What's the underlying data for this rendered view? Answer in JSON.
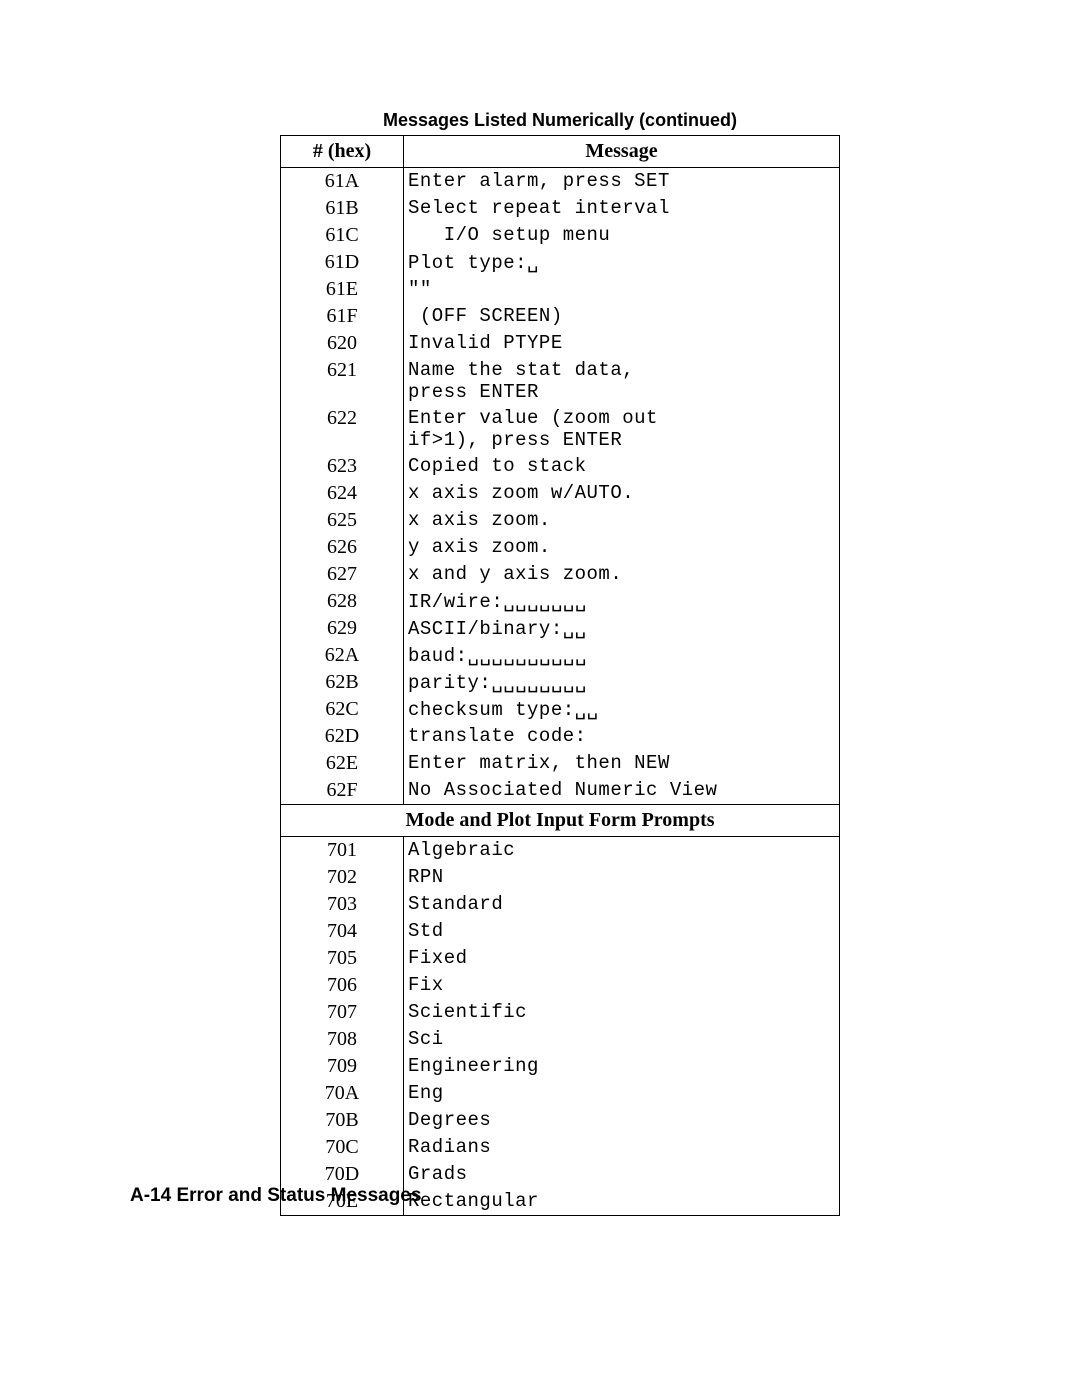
{
  "caption": "Messages Listed Numerically (continued)",
  "headers": {
    "hex": "# (hex)",
    "msg": "Message"
  },
  "section_title": "Mode and Plot Input Form Prompts",
  "footer": "A-14   Error and Status Messages",
  "rows1": [
    {
      "hex": "61A",
      "msg": "Enter alarm, press SET"
    },
    {
      "hex": "61B",
      "msg": "Select repeat interval"
    },
    {
      "hex": "61C",
      "msg": "   I/O setup menu"
    },
    {
      "hex": "61D",
      "msg": "Plot type:␣"
    },
    {
      "hex": "61E",
      "msg": "\"\""
    },
    {
      "hex": "61F",
      "msg": " (OFF SCREEN)"
    },
    {
      "hex": "620",
      "msg": "Invalid PTYPE"
    },
    {
      "hex": "621",
      "msg": "Name the stat data,\npress ENTER"
    },
    {
      "hex": "622",
      "msg": "Enter value (zoom out\nif>1), press ENTER"
    },
    {
      "hex": "623",
      "msg": "Copied to stack"
    },
    {
      "hex": "624",
      "msg": "x axis zoom w/AUTO."
    },
    {
      "hex": "625",
      "msg": "x axis zoom."
    },
    {
      "hex": "626",
      "msg": "y axis zoom."
    },
    {
      "hex": "627",
      "msg": "x and y axis zoom."
    },
    {
      "hex": "628",
      "msg": "IR/wire:␣␣␣␣␣␣␣"
    },
    {
      "hex": "629",
      "msg": "ASCII/binary:␣␣"
    },
    {
      "hex": "62A",
      "msg": "baud:␣␣␣␣␣␣␣␣␣␣"
    },
    {
      "hex": "62B",
      "msg": "parity:␣␣␣␣␣␣␣␣"
    },
    {
      "hex": "62C",
      "msg": "checksum type:␣␣"
    },
    {
      "hex": "62D",
      "msg": "translate code:"
    },
    {
      "hex": "62E",
      "msg": "Enter matrix, then NEW"
    },
    {
      "hex": "62F",
      "msg": "No Associated Numeric View"
    }
  ],
  "rows2": [
    {
      "hex": "701",
      "msg": "Algebraic"
    },
    {
      "hex": "702",
      "msg": "RPN"
    },
    {
      "hex": "703",
      "msg": "Standard"
    },
    {
      "hex": "704",
      "msg": "Std"
    },
    {
      "hex": "705",
      "msg": "Fixed"
    },
    {
      "hex": "706",
      "msg": "Fix"
    },
    {
      "hex": "707",
      "msg": "Scientific"
    },
    {
      "hex": "708",
      "msg": "Sci"
    },
    {
      "hex": "709",
      "msg": "Engineering"
    },
    {
      "hex": "70A",
      "msg": "Eng"
    },
    {
      "hex": "70B",
      "msg": "Degrees"
    },
    {
      "hex": "70C",
      "msg": "Radians"
    },
    {
      "hex": "70D",
      "msg": "Grads"
    },
    {
      "hex": "70E",
      "msg": "Rectangular"
    }
  ]
}
